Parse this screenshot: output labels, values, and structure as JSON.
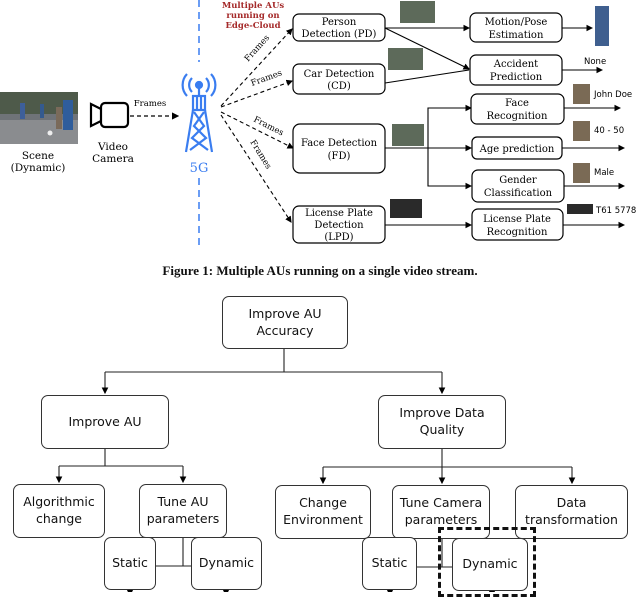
{
  "figure1": {
    "scene_label": [
      "Scene",
      "(Dynamic)"
    ],
    "camera_label": [
      "Video",
      "Camera"
    ],
    "frames_label": "Frames",
    "tower_label": "5G",
    "edge_label": [
      "Multiple AUs",
      "running on",
      "Edge-Cloud"
    ],
    "edge_label_color": "#a52a2a",
    "tower_color": "#3a7df0",
    "detectors": [
      {
        "lines": [
          "Person",
          "Detection (PD)"
        ]
      },
      {
        "lines": [
          "Car Detection",
          "(CD)"
        ]
      },
      {
        "lines": [
          "Face Detection",
          "(FD)"
        ]
      },
      {
        "lines": [
          "License Plate",
          "Detection",
          "(LPD)"
        ]
      }
    ],
    "analytics": [
      {
        "lines": [
          "Motion/Pose",
          "Estimation"
        ]
      },
      {
        "lines": [
          "Accident",
          "Prediction"
        ]
      },
      {
        "lines": [
          "Face",
          "Recognition"
        ]
      },
      {
        "lines": [
          "Age prediction"
        ]
      },
      {
        "lines": [
          "Gender",
          "Classification"
        ]
      },
      {
        "lines": [
          "License Plate",
          "Recognition"
        ]
      }
    ],
    "outputs": {
      "accident": "None",
      "face": "John Doe",
      "age": "40 - 50",
      "gender": "Male",
      "plate": "T61 5778"
    }
  },
  "caption": "Figure 1: Multiple AUs running on a single video stream.",
  "figure2": {
    "root": [
      "Improve AU",
      "Accuracy"
    ],
    "improve_au": [
      "Improve AU"
    ],
    "improve_data": [
      "Improve Data",
      "Quality"
    ],
    "algorithmic": [
      "Algorithmic",
      "change"
    ],
    "tune_au": [
      "Tune AU",
      "parameters"
    ],
    "change_env": [
      "Change",
      "Environment"
    ],
    "tune_camera": [
      "Tune Camera",
      "parameters"
    ],
    "data_transform": [
      "Data",
      "transformation"
    ],
    "static_a": "Static",
    "dynamic_a": "Dynamic",
    "static_b": "Static",
    "dynamic_b": "Dynamic"
  }
}
